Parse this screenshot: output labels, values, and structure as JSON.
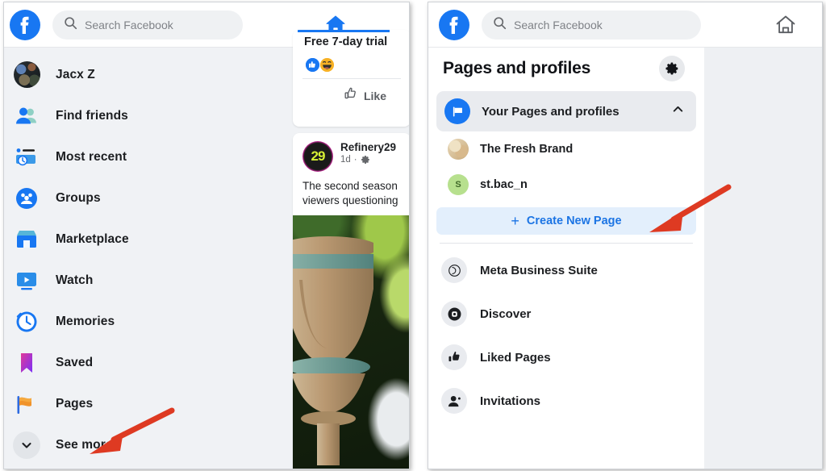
{
  "colors": {
    "fb_blue": "#1877f2",
    "link_blue": "#1b74e4",
    "arrow_red": "#DE3A22",
    "panel_bg": "#f0f2f5",
    "text_primary": "#1c1e21",
    "text_secondary": "#65676b"
  },
  "left_panel": {
    "topbar": {
      "logo": "facebook-logo",
      "search": {
        "placeholder": "Search Facebook",
        "value": "",
        "icon": "search-icon"
      },
      "home": {
        "icon": "home-icon",
        "label": "Home",
        "state": "active"
      }
    },
    "nav": {
      "items": [
        {
          "label": "Jacx Z",
          "icon": "user-avatar"
        },
        {
          "label": "Find friends",
          "icon": "friends-icon"
        },
        {
          "label": "Most recent",
          "icon": "most-recent-icon"
        },
        {
          "label": "Groups",
          "icon": "groups-icon"
        },
        {
          "label": "Marketplace",
          "icon": "marketplace-icon"
        },
        {
          "label": "Watch",
          "icon": "watch-icon"
        },
        {
          "label": "Memories",
          "icon": "memories-icon"
        },
        {
          "label": "Saved",
          "icon": "saved-bookmark-icon"
        },
        {
          "label": "Pages",
          "icon": "pages-flag-icon"
        },
        {
          "label": "See more",
          "icon": "chevron-down-icon"
        }
      ]
    },
    "feed": {
      "ad_card": {
        "title": "Free 7-day trial",
        "reactions": [
          "like-reaction",
          "haha-reaction"
        ],
        "like_label": "Like",
        "like_icon": "thumbs-up-outline-icon"
      },
      "post_card": {
        "author": "Refinery29",
        "avatar_text": "29",
        "time": "1d",
        "separator": "·",
        "audience_icon": "gear-icon",
        "body_line_1": "The second season",
        "body_line_2": "viewers questioning",
        "photo_alt": "garden-urn-photo"
      }
    },
    "annotation": {
      "arrow": "red-arrow-pointing-to-pages"
    }
  },
  "right_panel": {
    "topbar": {
      "logo": "facebook-logo",
      "search": {
        "placeholder": "Search Facebook",
        "value": "",
        "icon": "search-icon"
      },
      "home": {
        "icon": "home-outline-icon",
        "label": "Home",
        "state": "inactive"
      }
    },
    "header": {
      "title": "Pages and profiles",
      "settings_icon": "gear-icon"
    },
    "your_pages_section": {
      "label": "Your Pages and profiles",
      "icon": "flag-icon",
      "chevron": "chevron-up-icon",
      "expanded": true,
      "pages": [
        {
          "name": "The Fresh Brand",
          "avatar": "photo-avatar",
          "initial": ""
        },
        {
          "name": "st.bac_n",
          "avatar": "letter-avatar",
          "initial": "S"
        }
      ],
      "create_button": {
        "label": "Create New Page",
        "icon": "plus-icon"
      }
    },
    "menu": {
      "items": [
        {
          "label": "Meta Business Suite",
          "icon": "meta-logo-icon"
        },
        {
          "label": "Discover",
          "icon": "discover-compass-icon"
        },
        {
          "label": "Liked Pages",
          "icon": "thumbs-up-icon"
        },
        {
          "label": "Invitations",
          "icon": "person-add-icon"
        }
      ]
    },
    "annotation": {
      "arrow": "red-arrow-pointing-to-create-new-page"
    }
  }
}
